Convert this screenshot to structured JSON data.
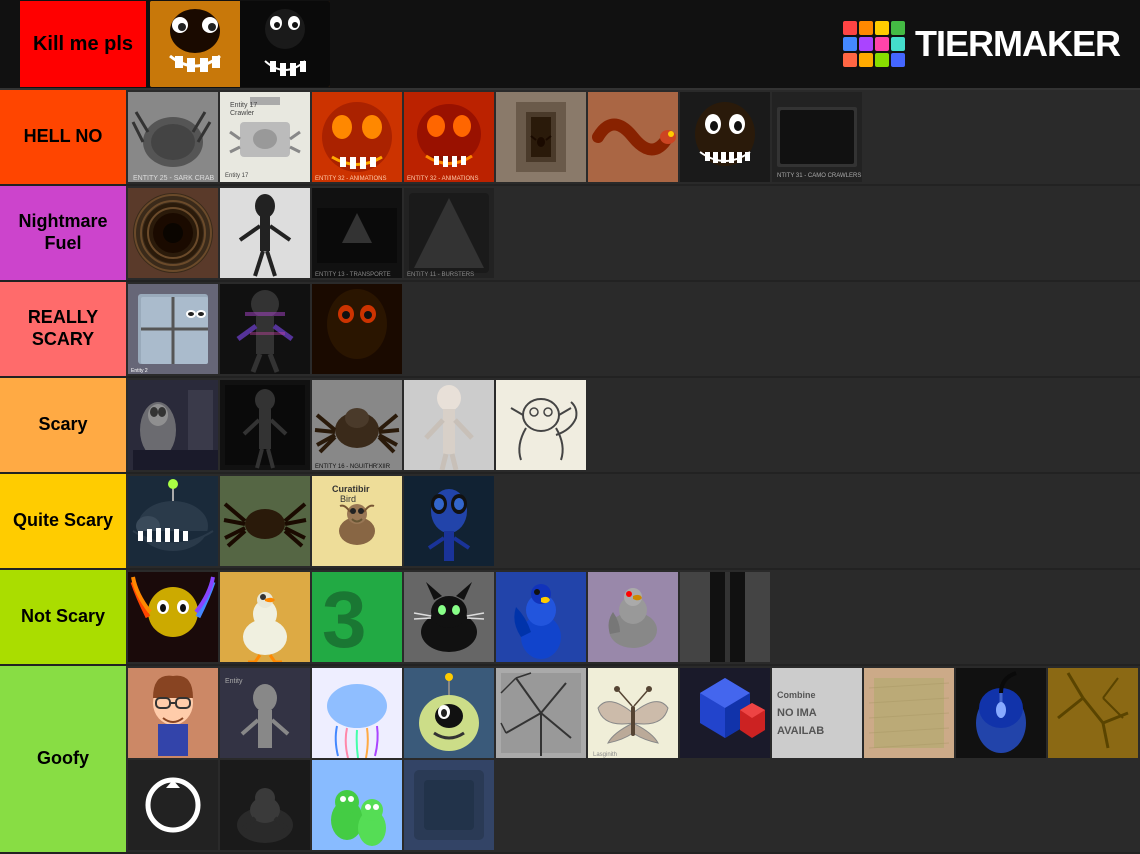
{
  "header": {
    "kill_label": "Kill me pls",
    "logo_text": "TiERMAKER",
    "logo_colors": [
      "#ff4444",
      "#ff8800",
      "#ffcc00",
      "#44bb44",
      "#4488ff",
      "#aa44ff",
      "#ff44aa",
      "#44ddcc",
      "#ff6644",
      "#ffaa00",
      "#88dd00",
      "#4466ff"
    ]
  },
  "tiers": [
    {
      "id": "kill",
      "label": "Kill me pls",
      "color": "#ff0000",
      "text_color": "#000",
      "cards": 2
    },
    {
      "id": "hellno",
      "label": "HELL NO",
      "color": "#ff4500",
      "text_color": "#000",
      "cards": 8
    },
    {
      "id": "nightmare",
      "label": "Nightmare Fuel",
      "color": "#cc44cc",
      "text_color": "#000",
      "cards": 4
    },
    {
      "id": "reallyscary",
      "label": "REALLY SCARY",
      "color": "#ff6b6b",
      "text_color": "#000",
      "cards": 3
    },
    {
      "id": "scary",
      "label": "Scary",
      "color": "#ffaa44",
      "text_color": "#000",
      "cards": 5
    },
    {
      "id": "quitescary",
      "label": "Quite Scary",
      "color": "#ffcc00",
      "text_color": "#000",
      "cards": 4
    },
    {
      "id": "notscary",
      "label": "Not Scary",
      "color": "#aadd00",
      "text_color": "#000",
      "cards": 7
    },
    {
      "id": "goofy",
      "label": "Goofy",
      "color": "#88dd44",
      "text_color": "#000",
      "cards": 14
    }
  ]
}
